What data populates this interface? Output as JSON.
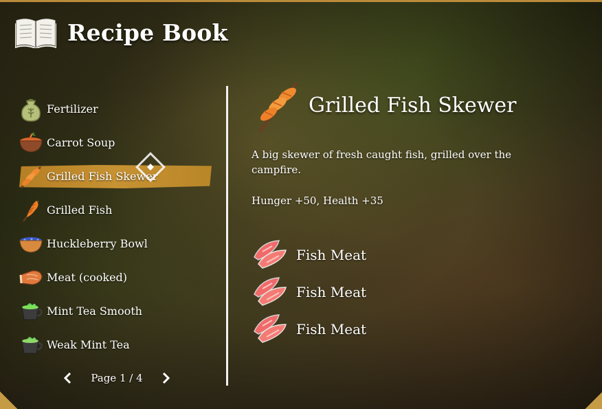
{
  "header": {
    "title": "Recipe Book",
    "icon": "open-book-icon"
  },
  "recipes": [
    {
      "label": "Fertilizer",
      "icon": "fertilizer-sack-icon",
      "selected": false
    },
    {
      "label": "Carrot Soup",
      "icon": "carrot-soup-bowl-icon",
      "selected": false
    },
    {
      "label": "Grilled Fish Skewer",
      "icon": "fish-skewer-icon",
      "selected": true
    },
    {
      "label": "Grilled Fish",
      "icon": "grilled-fish-icon",
      "selected": false
    },
    {
      "label": "Huckleberry Bowl",
      "icon": "huckleberry-bowl-icon",
      "selected": false
    },
    {
      "label": "Meat (cooked)",
      "icon": "cooked-meat-icon",
      "selected": false
    },
    {
      "label": "Mint Tea Smooth",
      "icon": "mint-tea-cup-icon",
      "selected": false
    },
    {
      "label": "Weak Mint Tea",
      "icon": "mint-tea-cup-icon",
      "selected": false
    }
  ],
  "pager": {
    "label": "Page 1 / 4",
    "current": 1,
    "total": 4
  },
  "detail": {
    "title": "Grilled Fish Skewer",
    "icon": "fish-skewer-icon",
    "description": "A big skewer of fresh caught fish, grilled over the campfire.",
    "stats": "Hunger +50, Health +35",
    "ingredients": [
      {
        "label": "Fish Meat",
        "icon": "fish-meat-icon"
      },
      {
        "label": "Fish Meat",
        "icon": "fish-meat-icon"
      },
      {
        "label": "Fish Meat",
        "icon": "fish-meat-icon"
      }
    ]
  },
  "colors": {
    "selection": "#c08a2c",
    "divider": "#f2f2f2",
    "text": "#ffffff"
  }
}
